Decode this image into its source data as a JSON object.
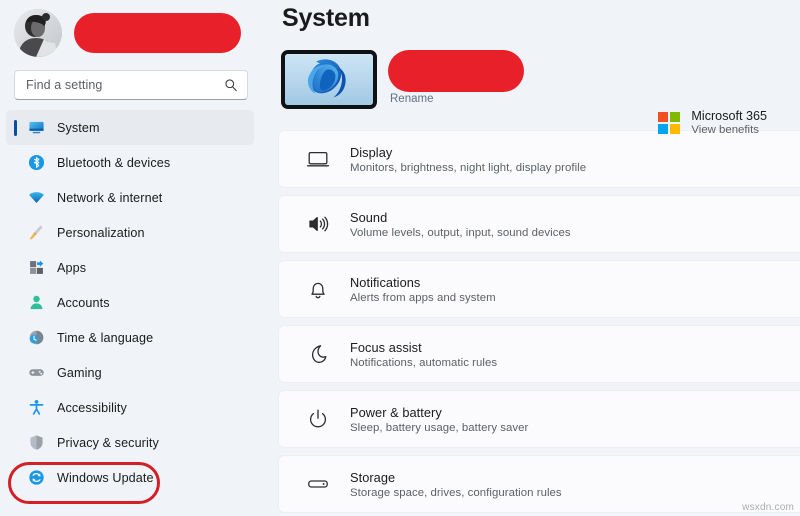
{
  "window": {
    "app": "Settings",
    "page_title": "System"
  },
  "account": {
    "avatar": "user-photo",
    "name_redacted": true
  },
  "search": {
    "placeholder": "Find a setting",
    "value": "",
    "icon": "search-icon"
  },
  "sidebar": {
    "items": [
      {
        "label": "System",
        "icon": "monitor-icon",
        "selected": true
      },
      {
        "label": "Bluetooth & devices",
        "icon": "bluetooth-icon",
        "selected": false
      },
      {
        "label": "Network & internet",
        "icon": "wifi-icon",
        "selected": false
      },
      {
        "label": "Personalization",
        "icon": "brush-icon",
        "selected": false
      },
      {
        "label": "Apps",
        "icon": "apps-icon",
        "selected": false
      },
      {
        "label": "Accounts",
        "icon": "person-icon",
        "selected": false
      },
      {
        "label": "Time & language",
        "icon": "clock-globe-icon",
        "selected": false
      },
      {
        "label": "Gaming",
        "icon": "gamepad-icon",
        "selected": false
      },
      {
        "label": "Accessibility",
        "icon": "accessibility-icon",
        "selected": false
      },
      {
        "label": "Privacy & security",
        "icon": "shield-icon",
        "selected": false
      },
      {
        "label": "Windows Update",
        "icon": "update-icon",
        "selected": false
      }
    ],
    "annotation": {
      "target": "Windows Update",
      "shape": "rounded-rectangle-outline",
      "color": "#d32027"
    }
  },
  "device": {
    "thumbnail": "windows11-bloom-wallpaper",
    "name_redacted": true,
    "rename_label": "Rename"
  },
  "microsoft365": {
    "title": "Microsoft 365",
    "subtitle": "View benefits",
    "logo_colors": [
      "#f25022",
      "#7fba00",
      "#00a4ef",
      "#ffb900"
    ]
  },
  "settings_list": [
    {
      "title": "Display",
      "subtitle": "Monitors, brightness, night light, display profile",
      "icon": "monitor-outline-icon"
    },
    {
      "title": "Sound",
      "subtitle": "Volume levels, output, input, sound devices",
      "icon": "speaker-icon"
    },
    {
      "title": "Notifications",
      "subtitle": "Alerts from apps and system",
      "icon": "bell-icon"
    },
    {
      "title": "Focus assist",
      "subtitle": "Notifications, automatic rules",
      "icon": "moon-icon"
    },
    {
      "title": "Power & battery",
      "subtitle": "Sleep, battery usage, battery saver",
      "icon": "power-icon"
    },
    {
      "title": "Storage",
      "subtitle": "Storage space, drives, configuration rules",
      "icon": "drive-icon"
    }
  ],
  "watermark": "wsxdn.com",
  "colors": {
    "page_background": "#f0f3f7",
    "card_background": "#fbfbfd",
    "accent": "#0a4f9e",
    "redaction": "#e8202a",
    "annotation": "#d32027"
  }
}
